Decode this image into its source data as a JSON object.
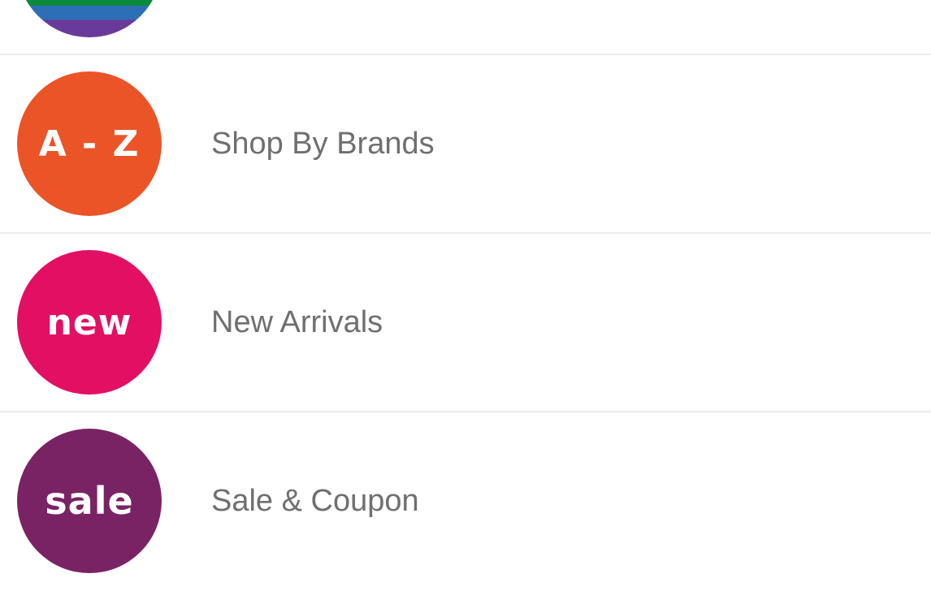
{
  "menu": {
    "items": [
      {
        "badge_text": "",
        "badge_color": "#0a8a3a",
        "label": ""
      },
      {
        "badge_text": "A - Z",
        "badge_color": "#ea5427",
        "label": "Shop By Brands"
      },
      {
        "badge_text": "new",
        "badge_color": "#e20f63",
        "label": "New Arrivals"
      },
      {
        "badge_text": "sale",
        "badge_color": "#7a2364",
        "label": "Sale & Coupon"
      }
    ]
  }
}
